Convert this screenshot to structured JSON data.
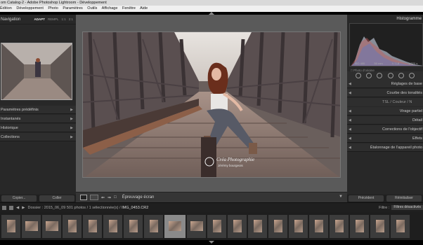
{
  "window": {
    "title": "om Catalog-2 - Adobe Photoshop Lightroom - Développement"
  },
  "menu": [
    "Édition",
    "Développement",
    "Photo",
    "Paramètres",
    "Outils",
    "Affichage",
    "Fenêtre",
    "Aide"
  ],
  "navigator": {
    "title": "Navigation",
    "options": [
      "ADAPT",
      "REMPL",
      "1:1",
      "2:1"
    ]
  },
  "left_panels": [
    "Paramètres prédéfinis",
    "Instantanés",
    "Historique",
    "Collections"
  ],
  "left_buttons": {
    "copy": "Copier...",
    "paste": "Coller"
  },
  "toolbar": {
    "softproof": "Épreuvage écran"
  },
  "histogram": {
    "title": "Histogramme",
    "iso": "ISO 400",
    "focal": "50 mm",
    "aperture": "f / 1,8",
    "shutter": "1/320 s",
    "original": "Photo d'origine"
  },
  "right_panels": {
    "basic": "Réglages de base",
    "tone_curve": "Courbe des tonalités",
    "hsl": [
      "TSL",
      "Couleur",
      "N"
    ],
    "split": "Virage partiel",
    "detail": "Détail",
    "lens": "Corrections de l'objectif",
    "effects": "Effets",
    "calibration": "Étalonnage de l'appareil photo"
  },
  "right_buttons": {
    "previous": "Précédent",
    "reset": "Réinitialiser"
  },
  "filmbar": {
    "folder": "Dossier : 2015_06_09",
    "count": "501 photos / 1 sélectionnée(s) /",
    "file": "IMG_0453.CR2",
    "filter_label": "Filtre :",
    "filter_value": "Filtres désactivés"
  },
  "watermark": {
    "line1": "Créa Photographie",
    "line2": "Jérémy bourgeois"
  }
}
